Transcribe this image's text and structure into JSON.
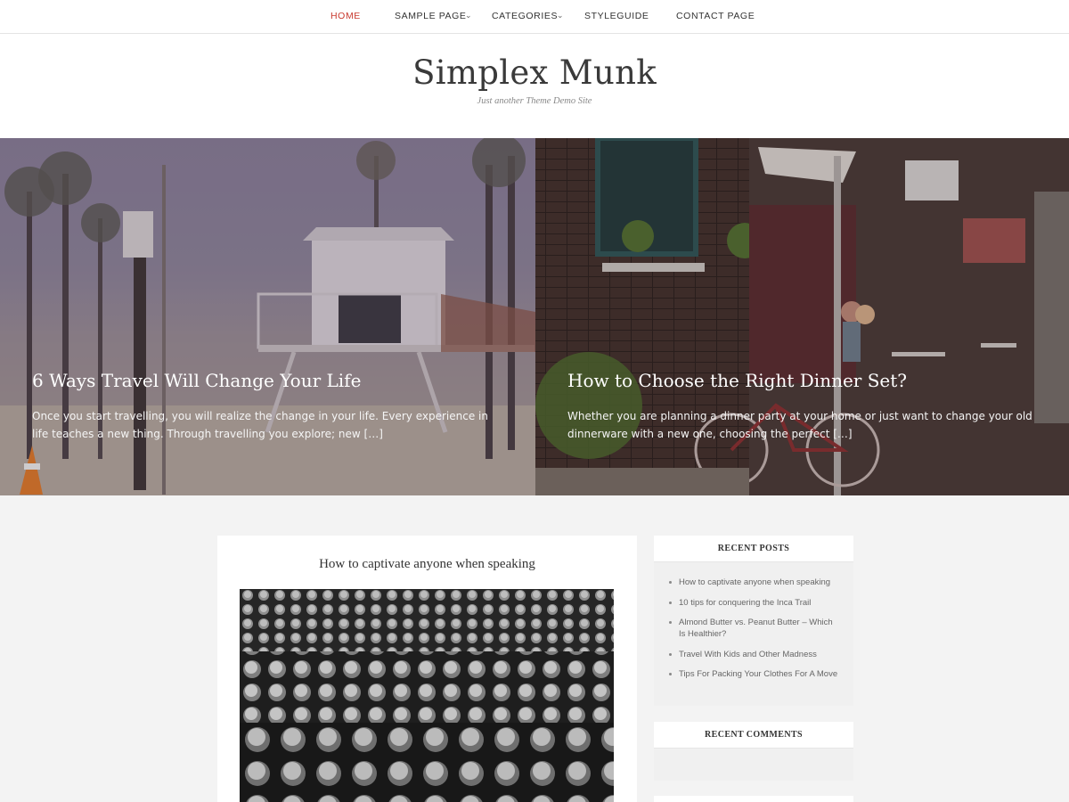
{
  "nav": {
    "items": [
      {
        "label": "HOME",
        "active": true
      },
      {
        "label": "SAMPLE PAGE",
        "has_dropdown": true
      },
      {
        "label": "CATEGORIES",
        "has_dropdown": true
      },
      {
        "label": "STYLEGUIDE"
      },
      {
        "label": "CONTACT PAGE"
      }
    ],
    "active_color": "#c8392e"
  },
  "site": {
    "title": "Simplex Munk",
    "tagline": "Just another Theme Demo Site"
  },
  "featured": [
    {
      "title": "6 Ways Travel Will Change Your Life",
      "excerpt": "Once you start travelling, you will realize the change in your life. Every experience in life teaches a new thing. Through travelling you explore; new […]"
    },
    {
      "title": "How to Choose the Right Dinner Set?",
      "excerpt": "Whether you are planning a dinner party at your home or just want to change your old dinnerware with a new one, choosing the perfect […]"
    }
  ],
  "post": {
    "title": "How to captivate anyone when speaking"
  },
  "sidebar": {
    "recent_posts": {
      "heading": "RECENT POSTS",
      "items": [
        "How to captivate anyone when speaking",
        "10 tips for conquering the Inca Trail",
        "Almond Butter vs. Peanut Butter – Which Is Healthier?",
        "Travel With Kids and Other Madness",
        "Tips For Packing Your Clothes For A Move"
      ]
    },
    "recent_comments": {
      "heading": "RECENT COMMENTS"
    }
  }
}
